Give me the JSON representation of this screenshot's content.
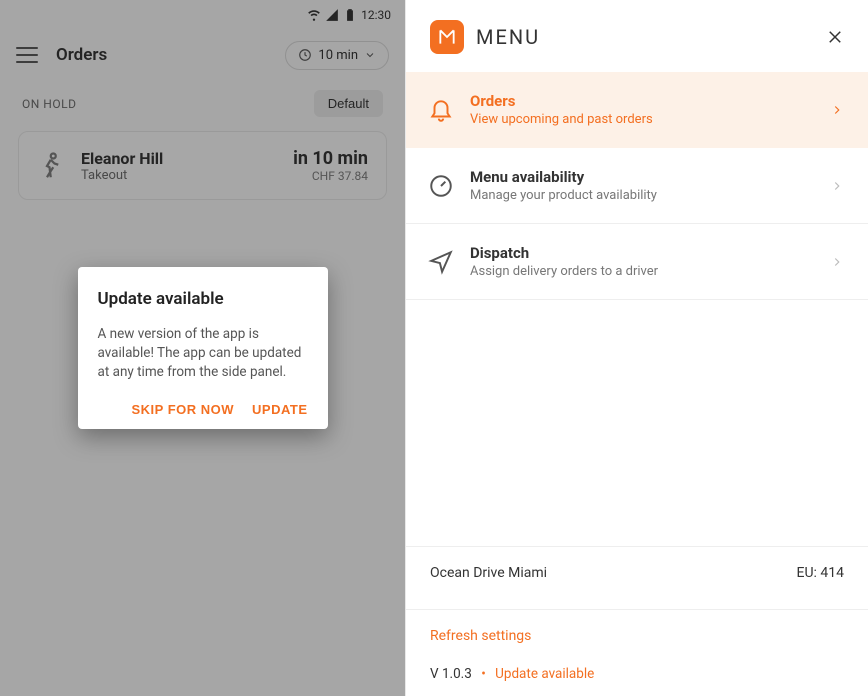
{
  "status_bar": {
    "time": "12:30"
  },
  "left": {
    "header_title": "Orders",
    "time_pill": "10 min",
    "section_label": "ON HOLD",
    "default_btn": "Default",
    "order": {
      "name": "Eleanor Hill",
      "type": "Takeout",
      "time": "in 10 min",
      "price": "CHF 37.84"
    },
    "modal": {
      "title": "Update available",
      "body": "A new version of the app is available! The app can be updated at any time from the side panel.",
      "skip": "SKIP FOR NOW",
      "update": "UPDATE"
    }
  },
  "right": {
    "menu_title": "MENU",
    "items": [
      {
        "title": "Orders",
        "sub": "View upcoming and past orders"
      },
      {
        "title": "Menu availability",
        "sub": "Manage your product availability"
      },
      {
        "title": "Dispatch",
        "sub": "Assign delivery orders to a driver"
      }
    ],
    "footer": {
      "location": "Ocean Drive Miami",
      "eu": "EU: 414",
      "refresh": "Refresh settings",
      "version": "V 1.0.3",
      "update": "Update available"
    }
  }
}
